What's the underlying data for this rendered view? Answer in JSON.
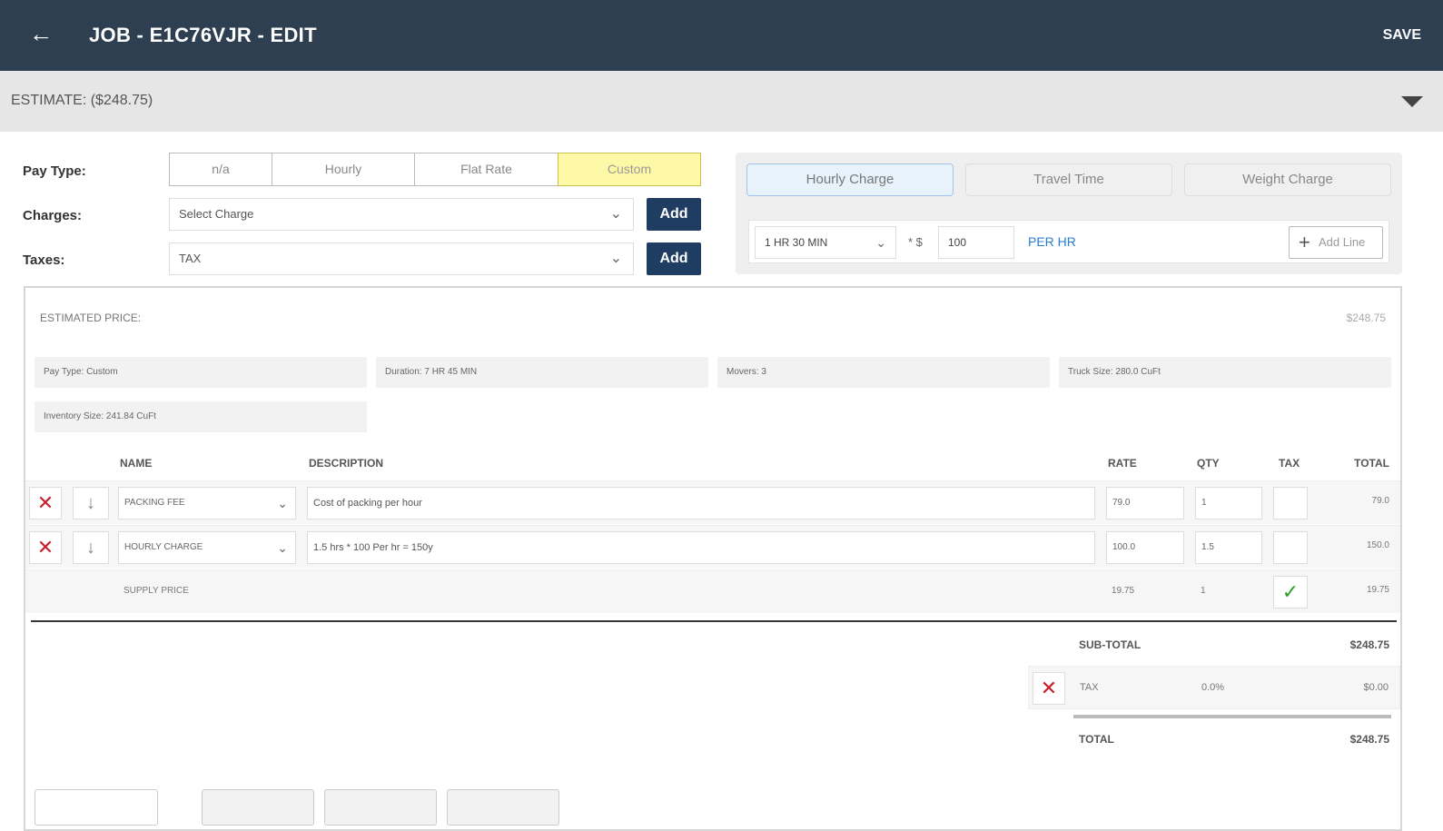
{
  "header": {
    "back_icon": "arrow-left-icon",
    "title": "JOB - E1C76VJR - EDIT",
    "save_label": "SAVE"
  },
  "estimate_bar": {
    "label": "ESTIMATE: ($248.75)",
    "expand_icon": "caret-down-icon"
  },
  "form": {
    "pay_type_label": "Pay Type:",
    "pay_types": [
      {
        "label": "n/a",
        "selected": false
      },
      {
        "label": "Hourly",
        "selected": false
      },
      {
        "label": "Flat Rate",
        "selected": false
      },
      {
        "label": "Custom",
        "selected": true
      }
    ],
    "charges_label": "Charges:",
    "charges_placeholder": "Select Charge",
    "taxes_label": "Taxes:",
    "taxes_value": "TAX",
    "add_label": "Add"
  },
  "charge_panel": {
    "tabs": [
      {
        "label": "Hourly Charge",
        "active": true
      },
      {
        "label": "Travel Time",
        "active": false
      },
      {
        "label": "Weight Charge",
        "active": false
      }
    ],
    "duration": "1 HR 30 MIN",
    "multiply": "* $",
    "rate": "100",
    "per_hr": "PER HR",
    "add_line": "Add Line"
  },
  "summary": {
    "estimated_price_label": "ESTIMATED PRICE:",
    "estimated_price_value": "$248.75",
    "info": {
      "pay_type": "Pay Type: Custom",
      "duration": "Duration: 7 HR 45 MIN",
      "movers": "Movers: 3",
      "truck_size": "Truck Size: 280.0 CuFt",
      "inventory_size": "Inventory Size: 241.84 CuFt"
    },
    "columns": {
      "name": "NAME",
      "description": "DESCRIPTION",
      "rate": "RATE",
      "qty": "QTY",
      "tax": "TAX",
      "total": "TOTAL"
    },
    "rows": [
      {
        "name": "PACKING FEE",
        "description": "Cost of packing per hour",
        "rate": "79.0",
        "qty": "1",
        "total": "79.0"
      },
      {
        "name": "HOURLY CHARGE",
        "description": "1.5 hrs * 100 Per hr = 150y",
        "rate": "100.0",
        "qty": "1.5",
        "total": "150.0"
      }
    ],
    "supply": {
      "name": "SUPPLY PRICE",
      "rate": "19.75",
      "qty": "1",
      "total": "19.75"
    },
    "subtotal_label": "SUB-TOTAL",
    "subtotal_value": "$248.75",
    "tax_row": {
      "label": "TAX",
      "pct": "0.0%",
      "amount": "$0.00"
    },
    "total_label": "TOTAL",
    "total_value": "$248.75"
  },
  "colors": {
    "header_bg": "#2f3f52",
    "accent_button": "#1f3d63",
    "custom_highlight": "#fdf9a6",
    "link_blue": "#2a7dd4",
    "delete_red": "#c8202a",
    "check_green": "#2aa22a"
  }
}
